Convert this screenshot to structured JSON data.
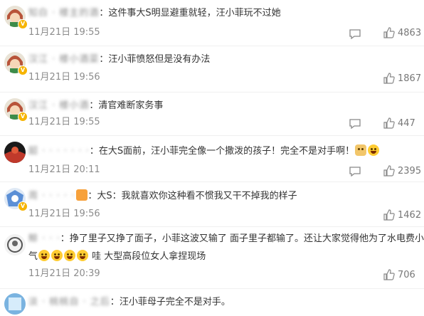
{
  "comments": [
    {
      "username": "知白 · 楼主的酒",
      "text": "这件事大S明显避重就轻，汪小菲玩不过她",
      "time": "11月21日 19:55",
      "likes": "4863",
      "avatar": "cartoon-girl-avatar"
    },
    {
      "username": "汉江 · 楼小酒菜",
      "text": "汪小菲愤怒但是没有办法",
      "time": "11月21日 19:56",
      "likes": "1867",
      "avatar": "cartoon-girl-avatar"
    },
    {
      "username": "汉江 · 楼小酒",
      "text": "清官难断家务事",
      "time": "11月21日 19:55",
      "likes": "447",
      "avatar": "cartoon-girl-avatar"
    },
    {
      "username": "韶 · · · · · · ·",
      "text": "在大S面前，汪小菲完全像一个撒泼的孩子！完全不是对手啊！",
      "time": "11月21日 20:11",
      "likes": "2395",
      "avatar": "red-black-avatar"
    },
    {
      "username": "周 · · · · ·",
      "text": "大S：我就喜欢你这种看不惯我又干不掉我的样子",
      "time": "11月21日 19:56",
      "likes": "1462",
      "avatar": "blue-anime-avatar"
    },
    {
      "username": "鲸 · · ·",
      "text_1": "挣了里子又挣了面子，小菲这波又输了 面子里子都输了。还让大家觉得他为了水电费小家子",
      "text_2a": "气",
      "text_2b": "哇 大型高段位女人拿捏现场",
      "time": "11月21日 20:39",
      "likes": "706",
      "avatar": "gray-round-avatar"
    },
    {
      "username": "淡 · 桃桃自 · 之后",
      "text": "汪小菲母子完全不是对手。",
      "avatar": "blue-square-avatar"
    }
  ],
  "colors": {
    "time": "#8c8c8c",
    "text": "#333333",
    "badge": "#f6b400"
  }
}
